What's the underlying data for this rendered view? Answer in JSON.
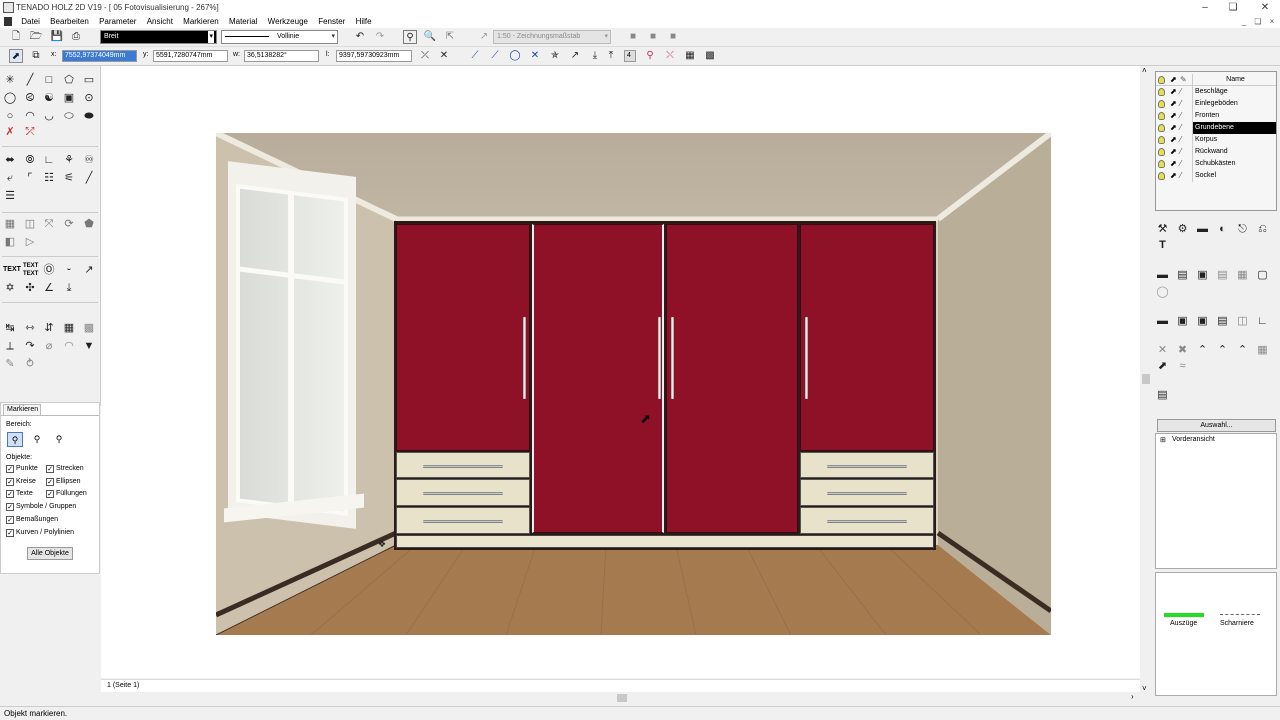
{
  "window": {
    "title": "TENADO HOLZ 2D V19 - [ 05 Fotovisualisierung - 267%]"
  },
  "menu": {
    "items": [
      "Datei",
      "Bearbeiten",
      "Parameter",
      "Ansicht",
      "Markieren",
      "Material",
      "Werkzeuge",
      "Fenster",
      "Hilfe"
    ]
  },
  "toolbar": {
    "linewidth": "Breit",
    "linetype": "Vollinie",
    "scale_placeholder": "1:50 - Zeichnungsmaßstab"
  },
  "coords": {
    "x_label": "x:",
    "x_value": "7552,97374049mm",
    "y_label": "y:",
    "y_value": "5591,7280747mm",
    "w_label": "w:",
    "w_value": "36,5138282°",
    "l_label": "l:",
    "l_value": "9397,59730923mm",
    "snap_value": "4"
  },
  "markpanel": {
    "tab": "Markieren",
    "bereich_label": "Bereich:",
    "objekte_label": "Objekte:",
    "checks": [
      "Punkte",
      "Strecken",
      "Kreise",
      "Ellipsen",
      "Texte",
      "Füllungen",
      "Symbole / Gruppen",
      "Bemaßungen",
      "Kurven / Polylinien"
    ],
    "all_button": "Alle Objekte"
  },
  "layers": {
    "header": "Name",
    "rows": [
      "Beschläge",
      "Einlegeböden",
      "Fronten",
      "Grundebene",
      "Korpus",
      "Rückwand",
      "Schubkästen",
      "Sockel"
    ],
    "active": "Grundebene"
  },
  "rightpanel": {
    "auswahl_button": "Auswahl...",
    "tree_item": "Vorderansicht",
    "legend": [
      {
        "label": "Auszüge",
        "color": "#22dd22"
      },
      {
        "label": "Scharniere",
        "color": "#666666"
      }
    ]
  },
  "canvas": {
    "page_tab": "1 (Seite 1)"
  },
  "status": {
    "text": "Objekt markieren."
  },
  "colors": {
    "front": "#8e1128",
    "drawer": "#e8e2ca",
    "accent": "#3b7bd6"
  }
}
